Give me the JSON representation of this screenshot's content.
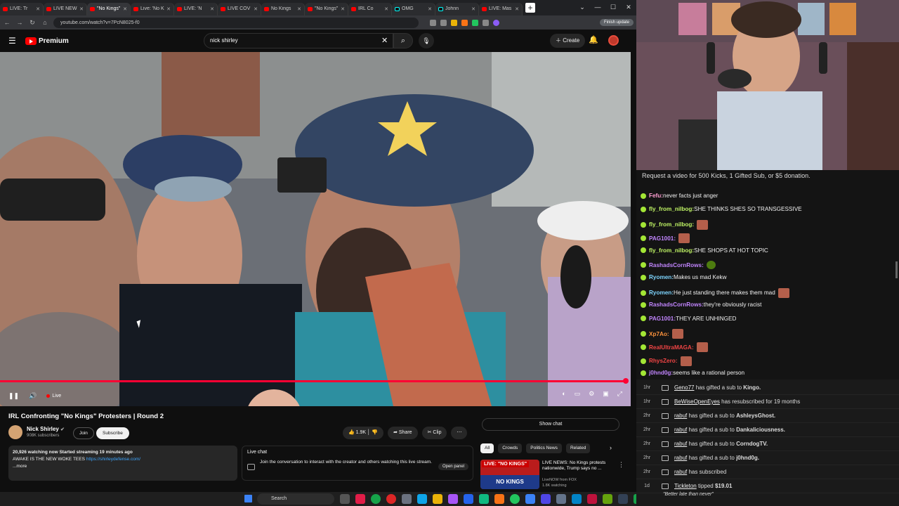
{
  "browser": {
    "tabs": [
      "LIVE: Tr",
      "LIVE NEWS",
      "\"No Kings\"",
      "Live: 'No K",
      "LIVE: 'N",
      "LIVE COV",
      "No Kings",
      "\"No Kings\"",
      "IRL Co",
      "OMG",
      "Johnn",
      "LIVE: Mas"
    ],
    "url": "youtube.com/watch?v=7PcN8025-f0",
    "finish_update": "Finish update"
  },
  "youtube": {
    "logo_text": "Premium",
    "search_value": "nick shirley",
    "create_label": "Create"
  },
  "player": {
    "live_label": "Live"
  },
  "video": {
    "title": "IRL Confronting \"No Kings\" Protesters | Round 2",
    "channel": "Nick Shirley",
    "subscribers": "908K subscribers",
    "join_label": "Join",
    "subscribe_label": "Subscribe",
    "likes": "1.9K",
    "share_label": "Share",
    "clip_label": "Clip",
    "desc_line1": "20,926 watching now  Started streaming 19 minutes ago",
    "desc_line2": "AWAKE IS THE NEW WOKE TEES ",
    "desc_link": "https://shirleydefense.com/",
    "desc_more": "...more"
  },
  "live_chat_box": {
    "title": "Live chat",
    "text": "Join the conversation to interact with the creator and others watching this live stream.",
    "open_panel": "Open panel"
  },
  "sidebar": {
    "show_chat": "Show chat",
    "chips": [
      "All",
      "Crowds",
      "Politics News",
      "Related"
    ],
    "rec_thumb_live": "LIVE: \"NO KINGS\"",
    "rec_thumb_text": "NO KINGS",
    "rec_title": "LIVE NEWS: No Kings protests nationwide, Trump says no ...",
    "rec_channel": "LiveNOW from FOX",
    "rec_views": "1.8K watching"
  },
  "taskbar": {
    "search": "Search"
  },
  "stream_chat": {
    "banner": "Request a video for 500 Kicks, 1 Gifted Sub, or $5 donation.",
    "messages": [
      {
        "user": "Fefu",
        "text": " never facts just anger",
        "color": "#ff9ed2",
        "emote": false
      },
      {
        "user": "fly_from_nilbog",
        "text": " SHE THINKS SHES SO TRANSGESSIVE",
        "color": "#bef264",
        "emote": false
      },
      {
        "user": "fly_from_nilbog",
        "text": "",
        "color": "#bef264",
        "emote": true
      },
      {
        "user": "PAG1001",
        "text": "",
        "color": "#c084fc",
        "emote": true
      },
      {
        "user": "fly_from_nilbog",
        "text": " SHE SHOPS AT HOT TOPIC",
        "color": "#bef264",
        "emote": false
      },
      {
        "user": "RashadsCornRows",
        "text": "",
        "color": "#c084fc",
        "emote": true
      },
      {
        "user": "Ryomen",
        "text": " Makes us mad Kekw",
        "color": "#7dd3fc",
        "emote": false
      },
      {
        "user": "Ryomen",
        "text": " He just standing there makes them mad",
        "color": "#7dd3fc",
        "emote": true
      },
      {
        "user": "RashadsCornRows",
        "text": " they're obviously racist",
        "color": "#c084fc",
        "emote": false
      },
      {
        "user": "PAG1001",
        "text": " THEY ARE UNHINGED",
        "color": "#c084fc",
        "emote": false
      },
      {
        "user": "Xp7Ao",
        "text": "",
        "color": "#fb923c",
        "emote": true
      },
      {
        "user": "RealUltraMAGA",
        "text": "",
        "color": "#ef4444",
        "emote": true
      },
      {
        "user": "RhysZero",
        "text": "",
        "color": "#ef4444",
        "emote": true
      },
      {
        "user": "j0hnd0g",
        "text": " seems like a rational person",
        "color": "#c084fc",
        "emote": false
      }
    ]
  },
  "events": [
    {
      "time": "1hr",
      "name": "Geno77",
      "text": " has gifted a sub to ",
      "target": "Kingo."
    },
    {
      "time": "1hr",
      "name": "BeWiseOpenEyes",
      "text": " has resubscribed for 19 months",
      "target": ""
    },
    {
      "time": "2hr",
      "name": "rabuf",
      "text": " has gifted a sub to ",
      "target": "AshleysGhost."
    },
    {
      "time": "2hr",
      "name": "rabuf",
      "text": " has gifted a sub to ",
      "target": "Dankaliciousness."
    },
    {
      "time": "2hr",
      "name": "rabuf",
      "text": " has gifted a sub to ",
      "target": "CorndogTV."
    },
    {
      "time": "2hr",
      "name": "rabuf",
      "text": " has gifted a sub to ",
      "target": "j0hnd0g."
    },
    {
      "time": "2hr",
      "name": "rabuf",
      "text": " has subscribed",
      "target": ""
    },
    {
      "time": "1d",
      "name": "Tickleton",
      "text": " tipped ",
      "target": "$19.01"
    }
  ],
  "tip_message": "\"Better late than never\"",
  "colors": {
    "accent": "#ff0000",
    "progress": "#ff0033"
  }
}
